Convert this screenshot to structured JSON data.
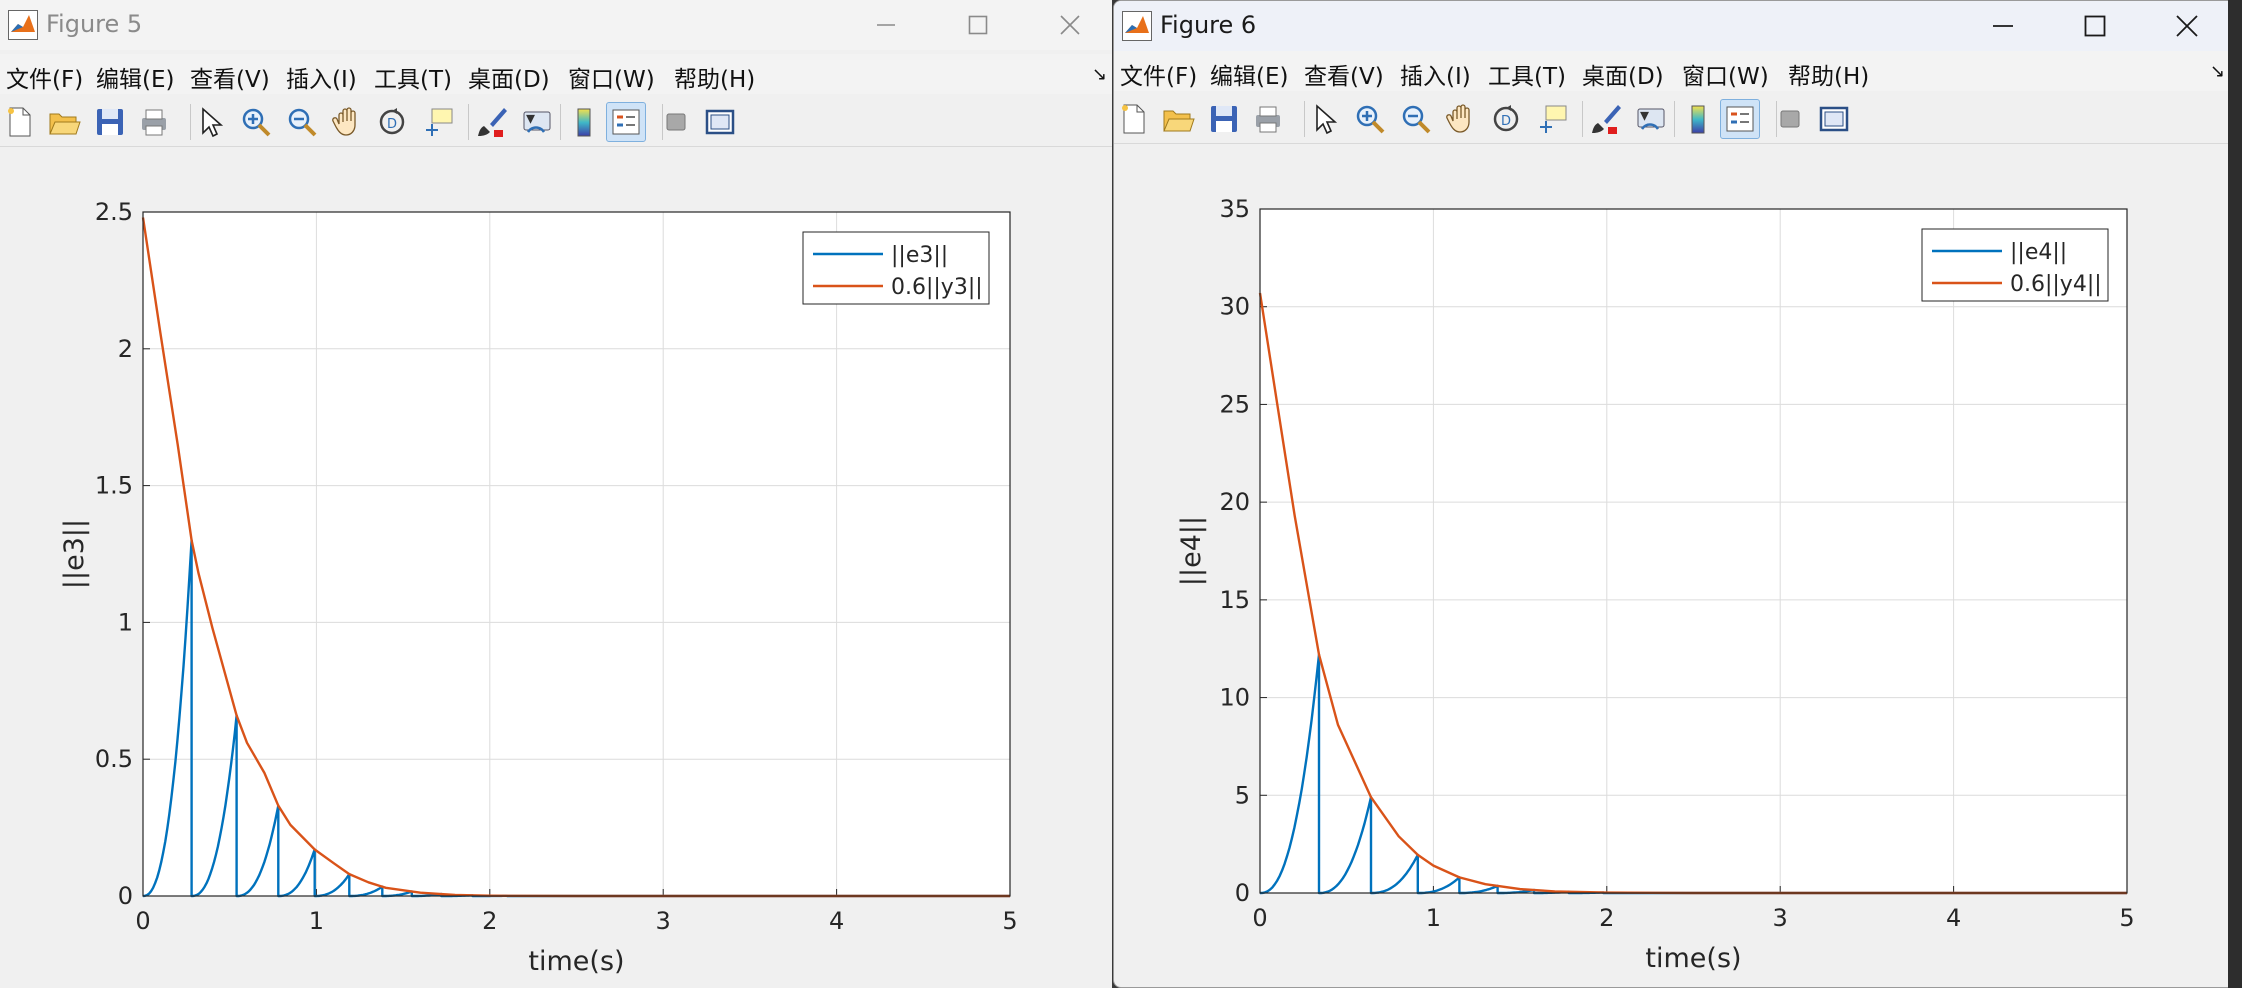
{
  "menu": [
    "文件(F)",
    "编辑(E)",
    "查看(V)",
    "插入(I)",
    "工具(T)",
    "桌面(D)",
    "窗口(W)",
    "帮助(H)"
  ],
  "menu_more": "↘",
  "toolbar_icons": [
    "new-file-icon",
    "open-folder-icon",
    "save-icon",
    "print-icon",
    "select-arrow-icon",
    "zoom-in-icon",
    "zoom-out-icon",
    "pan-hand-icon",
    "rotate-3d-icon",
    "data-cursor-icon",
    "brush-icon",
    "link-plot-icon",
    "colorbar-icon",
    "legend-icon",
    "hide-tools-icon",
    "dock-icon"
  ],
  "colors": {
    "series1": "#0072BD",
    "series2": "#D95319",
    "grid": "#dcdcdc",
    "axes_bg": "#ffffff"
  },
  "fig5": {
    "title": "Figure 5",
    "chart_data": {
      "type": "line",
      "xlabel": "time(s)",
      "ylabel": "||e3||",
      "xlim": [
        0,
        5
      ],
      "ylim": [
        0,
        2.5
      ],
      "xticks": [
        "0",
        "1",
        "2",
        "3",
        "4",
        "5"
      ],
      "yticks": [
        "0",
        "0.5",
        "1",
        "1.5",
        "2",
        "2.5"
      ],
      "grid": true,
      "legend_position": "top-right",
      "series": [
        {
          "name": "||e3||",
          "events": [
            0,
            0.28,
            0.54,
            0.78,
            0.99,
            1.19,
            1.38,
            1.55,
            1.72,
            1.9
          ]
        },
        {
          "name": "0.6||y3||",
          "points": [
            [
              0,
              2.48
            ],
            [
              0.1,
              2.06
            ],
            [
              0.2,
              1.65
            ],
            [
              0.28,
              1.3
            ],
            [
              0.32,
              1.18
            ],
            [
              0.4,
              0.98
            ],
            [
              0.54,
              0.66
            ],
            [
              0.6,
              0.56
            ],
            [
              0.7,
              0.45
            ],
            [
              0.78,
              0.33
            ],
            [
              0.85,
              0.26
            ],
            [
              0.99,
              0.17
            ],
            [
              1.1,
              0.12
            ],
            [
              1.19,
              0.08
            ],
            [
              1.3,
              0.05
            ],
            [
              1.4,
              0.03
            ],
            [
              1.6,
              0.012
            ],
            [
              1.8,
              0.004
            ],
            [
              2.0,
              0.001
            ],
            [
              2.5,
              0
            ],
            [
              5,
              0
            ]
          ]
        }
      ]
    }
  },
  "fig6": {
    "title": "Figure 6",
    "chart_data": {
      "type": "line",
      "xlabel": "time(s)",
      "ylabel": "||e4||",
      "xlim": [
        0,
        5
      ],
      "ylim": [
        0,
        35
      ],
      "xticks": [
        "0",
        "1",
        "2",
        "3",
        "4",
        "5"
      ],
      "yticks": [
        "0",
        "5",
        "10",
        "15",
        "20",
        "25",
        "30",
        "35"
      ],
      "grid": true,
      "legend_position": "top-right",
      "series": [
        {
          "name": "||e4||",
          "events": [
            0,
            0.34,
            0.64,
            0.91,
            1.15,
            1.37,
            1.58,
            1.78
          ]
        },
        {
          "name": "0.6||y4||",
          "points": [
            [
              0,
              30.7
            ],
            [
              0.1,
              25
            ],
            [
              0.2,
              19.3
            ],
            [
              0.34,
              12.2
            ],
            [
              0.45,
              8.6
            ],
            [
              0.64,
              4.9
            ],
            [
              0.8,
              2.9
            ],
            [
              0.91,
              1.95
            ],
            [
              1.0,
              1.4
            ],
            [
              1.15,
              0.8
            ],
            [
              1.3,
              0.45
            ],
            [
              1.5,
              0.2
            ],
            [
              1.7,
              0.08
            ],
            [
              2.0,
              0.02
            ],
            [
              2.5,
              0
            ],
            [
              5,
              0
            ]
          ]
        }
      ]
    }
  }
}
